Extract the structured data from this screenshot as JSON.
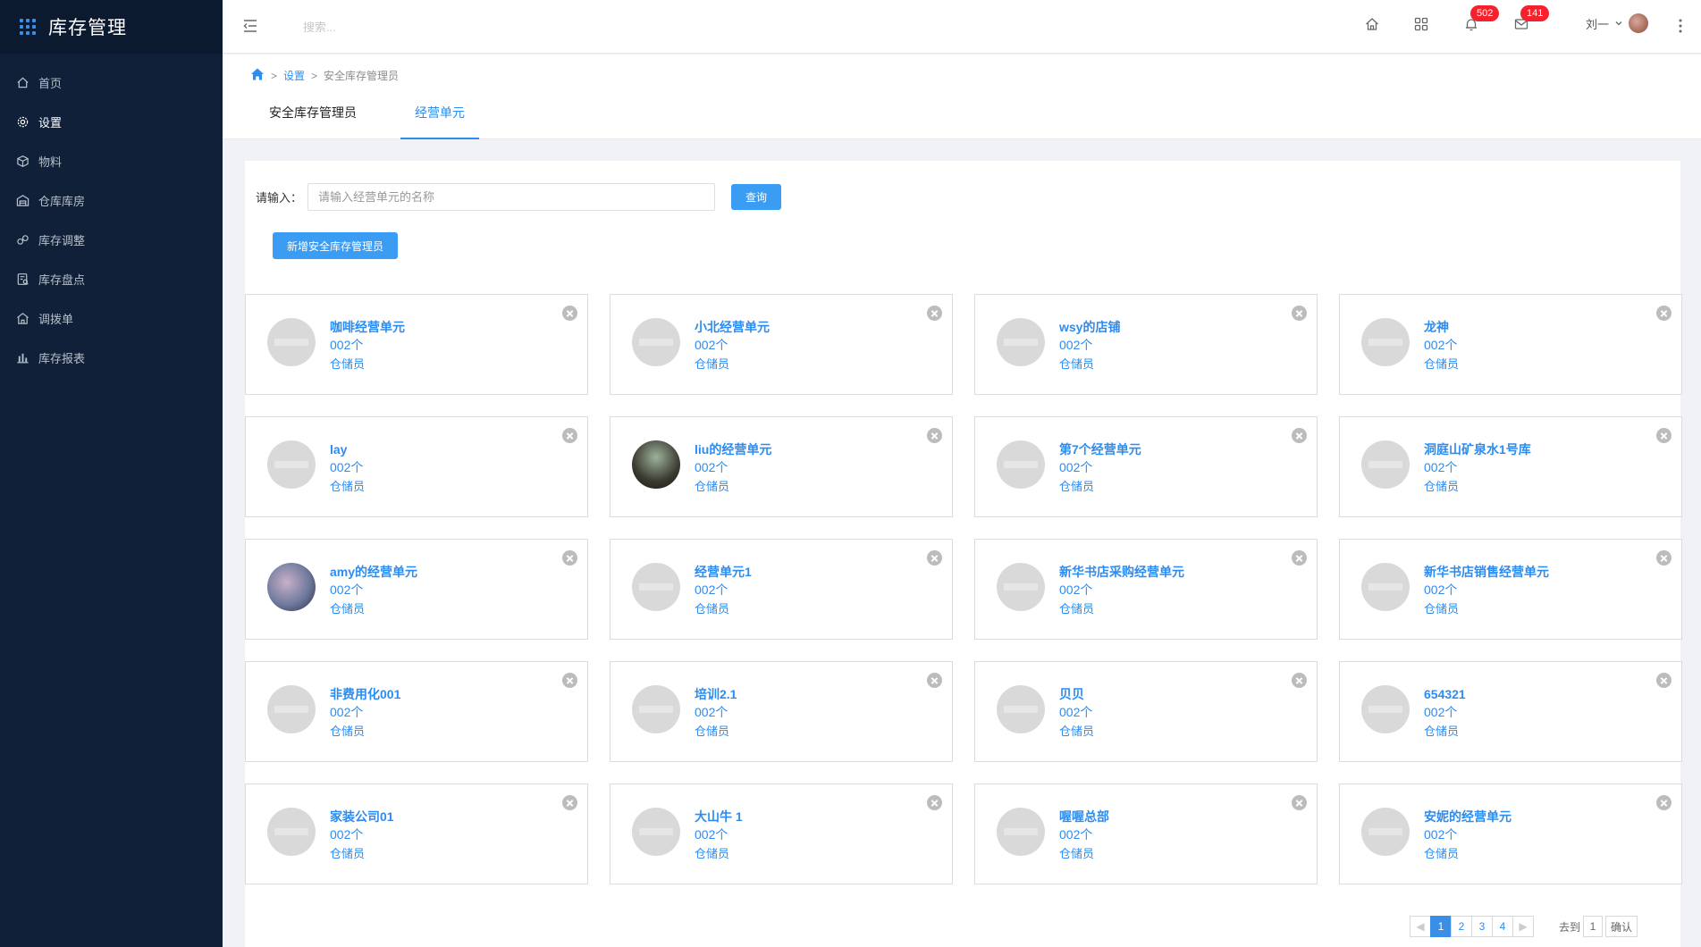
{
  "app": {
    "title": "库存管理"
  },
  "sidebar": {
    "items": [
      {
        "label": "首页",
        "icon": "home-icon"
      },
      {
        "label": "设置",
        "icon": "gear-icon"
      },
      {
        "label": "物料",
        "icon": "box-icon"
      },
      {
        "label": "仓库库房",
        "icon": "warehouse-icon"
      },
      {
        "label": "库存调整",
        "icon": "adjust-icon"
      },
      {
        "label": "库存盘点",
        "icon": "inventory-check-icon"
      },
      {
        "label": "调拨单",
        "icon": "transfer-icon"
      },
      {
        "label": "库存报表",
        "icon": "bar-chart-icon"
      }
    ],
    "active_index": 1
  },
  "header": {
    "search_placeholder": "搜索...",
    "notifications_badge": "502",
    "messages_badge": "141",
    "user_name": "刘一"
  },
  "breadcrumb": {
    "items": [
      "设置",
      "安全库存管理员"
    ]
  },
  "tabs": [
    {
      "label": "安全库存管理员",
      "active": false
    },
    {
      "label": "经营单元",
      "active": true
    }
  ],
  "filter": {
    "label": "请输入：",
    "placeholder": "请输入经营单元的名称",
    "value": "",
    "query_button": "查询",
    "add_button": "新增安全库存管理员"
  },
  "cards": [
    {
      "title": "咖啡经营单元",
      "count": "002个",
      "role": "仓储员",
      "avatar": "default"
    },
    {
      "title": "小北经营单元",
      "count": "002个",
      "role": "仓储员",
      "avatar": "default"
    },
    {
      "title": "wsy的店铺",
      "count": "002个",
      "role": "仓储员",
      "avatar": "default"
    },
    {
      "title": "龙神",
      "count": "002个",
      "role": "仓储员",
      "avatar": "default"
    },
    {
      "title": "lay",
      "count": "002个",
      "role": "仓储员",
      "avatar": "default"
    },
    {
      "title": "liu的经营单元",
      "count": "002个",
      "role": "仓储员",
      "avatar": "photo1"
    },
    {
      "title": "第7个经营单元",
      "count": "002个",
      "role": "仓储员",
      "avatar": "default"
    },
    {
      "title": "洞庭山矿泉水1号库",
      "count": "002个",
      "role": "仓储员",
      "avatar": "default"
    },
    {
      "title": "amy的经营单元",
      "count": "002个",
      "role": "仓储员",
      "avatar": "photo2"
    },
    {
      "title": "经营单元1",
      "count": "002个",
      "role": "仓储员",
      "avatar": "default"
    },
    {
      "title": "新华书店采购经营单元",
      "count": "002个",
      "role": "仓储员",
      "avatar": "default"
    },
    {
      "title": "新华书店销售经营单元",
      "count": "002个",
      "role": "仓储员",
      "avatar": "default"
    },
    {
      "title": "非费用化001",
      "count": "002个",
      "role": "仓储员",
      "avatar": "default"
    },
    {
      "title": "培训2.1",
      "count": "002个",
      "role": "仓储员",
      "avatar": "default"
    },
    {
      "title": "贝贝",
      "count": "002个",
      "role": "仓储员",
      "avatar": "default"
    },
    {
      "title": "654321",
      "count": "002个",
      "role": "仓储员",
      "avatar": "default"
    },
    {
      "title": "家装公司01",
      "count": "002个",
      "role": "仓储员",
      "avatar": "default"
    },
    {
      "title": "大山牛 1",
      "count": "002个",
      "role": "仓储员",
      "avatar": "default"
    },
    {
      "title": "喔喔总部",
      "count": "002个",
      "role": "仓储员",
      "avatar": "default"
    },
    {
      "title": "安妮的经营单元",
      "count": "002个",
      "role": "仓储员",
      "avatar": "default"
    }
  ],
  "pagination": {
    "pages": [
      "1",
      "2",
      "3",
      "4"
    ],
    "current": "1",
    "goto_label": "去到",
    "goto_value": "1",
    "confirm_label": "确认"
  },
  "colors": {
    "sidebar_bg": "#0f2038",
    "accent": "#2d8cf0",
    "button": "#3a9cf3",
    "badge": "#f5222d"
  }
}
